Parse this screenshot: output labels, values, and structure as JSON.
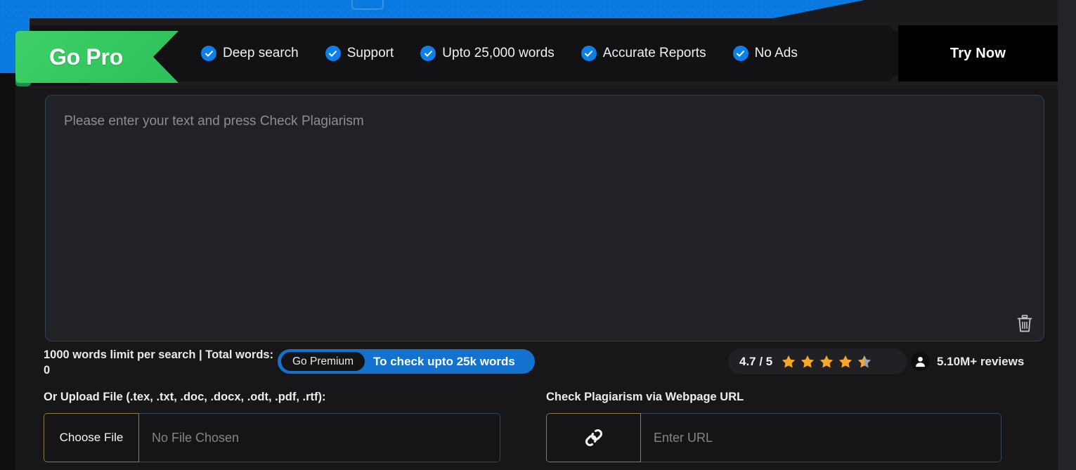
{
  "promo": {
    "ribbon_label": "Go Pro",
    "try_now_label": "Try Now",
    "features": [
      {
        "label": "Deep search",
        "icon": "check-circle-icon"
      },
      {
        "label": "Support",
        "icon": "check-circle-icon"
      },
      {
        "label": "Upto 25,000 words",
        "icon": "check-circle-icon"
      },
      {
        "label": "Accurate Reports",
        "icon": "check-circle-icon"
      },
      {
        "label": "No Ads",
        "icon": "check-circle-icon"
      }
    ]
  },
  "editor": {
    "placeholder": "Please enter your text and press Check Plagiarism",
    "value": "",
    "clear_icon": "trash-icon"
  },
  "meta": {
    "words_limit_text": "1000 words limit per search | Total words: 0",
    "premium_button_label": "Go Premium",
    "premium_button_text": "To check upto 25k words",
    "rating_score": "4.7 / 5",
    "stars_filled": 4,
    "stars_half": 1,
    "stars_total": 5,
    "reviews_label": "5.10M+ reviews",
    "reviews_icon": "user-avatar-icon"
  },
  "upload": {
    "label": "Or Upload File (.tex, .txt, .doc, .docx, .odt, .pdf, .rtf):",
    "button_label": "Choose File",
    "file_status": "No File Chosen"
  },
  "url": {
    "label": "Check Plagiarism via Webpage URL",
    "icon": "link-chain-icon",
    "placeholder": "Enter URL",
    "value": ""
  },
  "colors": {
    "accent_blue": "#0b7ae0",
    "ribbon_green": "#34c75f",
    "star_gold": "#f9a825",
    "star_empty": "#9aa3ad",
    "page_bg": "#171719"
  }
}
